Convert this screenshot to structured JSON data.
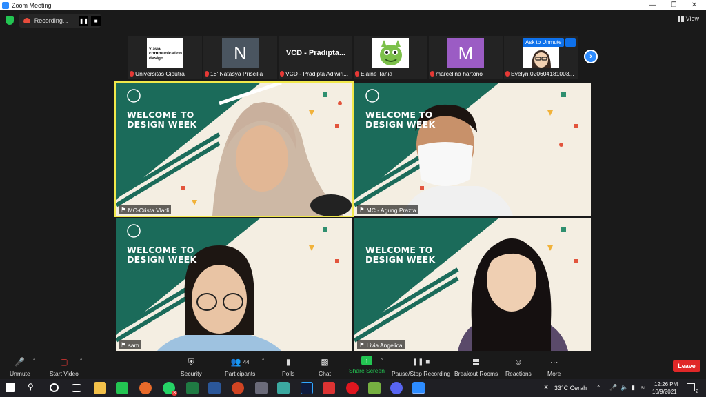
{
  "window": {
    "title": "Zoom Meeting"
  },
  "topbar": {
    "recording_label": "Recording...",
    "view_label": "View"
  },
  "thumbnails": [
    {
      "name": "Universitas Ciputra",
      "avatar_text": "visual communication design",
      "avatar_bg": "#ffffff",
      "avatar_fg": "#111111"
    },
    {
      "name": "18' Natasya Priscilla",
      "avatar_text": "N",
      "avatar_bg": "#4a5560",
      "avatar_fg": "#ffffff"
    },
    {
      "name": "VCD - Pradipta Adiwiri...",
      "avatar_text": "VCD - Pradipta...",
      "avatar_bg": "#232323",
      "avatar_fg": "#ffffff"
    },
    {
      "name": "Elaine Tania",
      "avatar_text": "",
      "avatar_bg": "#ffffff",
      "avatar_fg": "#7cc04a"
    },
    {
      "name": "marcelina hartono",
      "avatar_text": "M",
      "avatar_bg": "#9b5cc4",
      "avatar_fg": "#ffffff"
    },
    {
      "name": "Evelyn.020604181003...",
      "avatar_text": "",
      "avatar_bg": "#ffffff",
      "avatar_fg": "#333333"
    }
  ],
  "hover_controls": {
    "ask_unmute": "Ask to Unmute",
    "more": "···"
  },
  "tiles": [
    {
      "name": "MC-Crista Vladi",
      "title_line1": "WELCOME TO",
      "title_line2": "DESIGN WEEK",
      "active": true
    },
    {
      "name": "MC - Agung Prazta",
      "title_line1": "WELCOME TO",
      "title_line2": "DESIGN WEEK",
      "active": false
    },
    {
      "name": "sam",
      "title_line1": "WELCOME TO",
      "title_line2": "DESIGN WEEK",
      "active": false
    },
    {
      "name": "Livia Angelica",
      "title_line1": "WELCOME TO",
      "title_line2": "DESIGN WEEK",
      "active": false
    }
  ],
  "toolbar": {
    "unmute": "Unmute",
    "start_video": "Start Video",
    "security": "Security",
    "participants": "Participants",
    "participants_count": "44",
    "polls": "Polls",
    "chat": "Chat",
    "share_screen": "Share Screen",
    "pause_stop": "Pause/Stop Recording",
    "breakout": "Breakout Rooms",
    "reactions": "Reactions",
    "more": "More",
    "leave": "Leave"
  },
  "taskbar": {
    "weather": "33°C  Cerah",
    "time": "12:26 PM",
    "date": "10/9/2021",
    "notif_count": "2",
    "whatsapp_badge": "3"
  },
  "colors": {
    "accent": "#2d8cff",
    "teal": "#1b6b5a",
    "leave": "#e02828",
    "share": "#23c552"
  }
}
